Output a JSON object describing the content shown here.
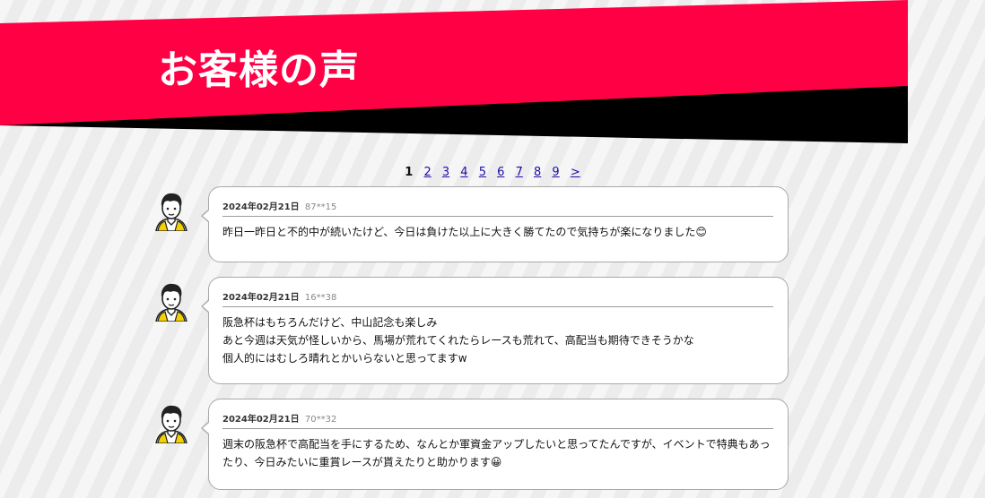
{
  "banner": {
    "title": "お客様の声"
  },
  "pagination": {
    "current": "1",
    "pages": [
      "2",
      "3",
      "4",
      "5",
      "6",
      "7",
      "8",
      "9"
    ],
    "next": ">"
  },
  "colors": {
    "banner_red": "#ff0044",
    "banner_black": "#000000"
  },
  "comments": [
    {
      "date": "2024年02月21日",
      "user": "87**15",
      "lines": [
        "昨日一昨日と不的中が続いたけど、今日は負けた以上に大きく勝てたので気持ちが楽になりました😊"
      ]
    },
    {
      "date": "2024年02月21日",
      "user": "16**38",
      "lines": [
        "阪急杯はもちろんだけど、中山記念も楽しみ",
        "あと今週は天気が怪しいから、馬場が荒れてくれたらレースも荒れて、高配当も期待できそうかな",
        "個人的にはむしろ晴れとかいらないと思ってますw"
      ]
    },
    {
      "date": "2024年02月21日",
      "user": "70**32",
      "lines": [
        "週末の阪急杯で高配当を手にするため、なんとか軍資金アップしたいと思ってたんですが、イベントで特典もあっ",
        "たり、今日みたいに重賞レースが貰えたりと助かります😀"
      ]
    }
  ]
}
